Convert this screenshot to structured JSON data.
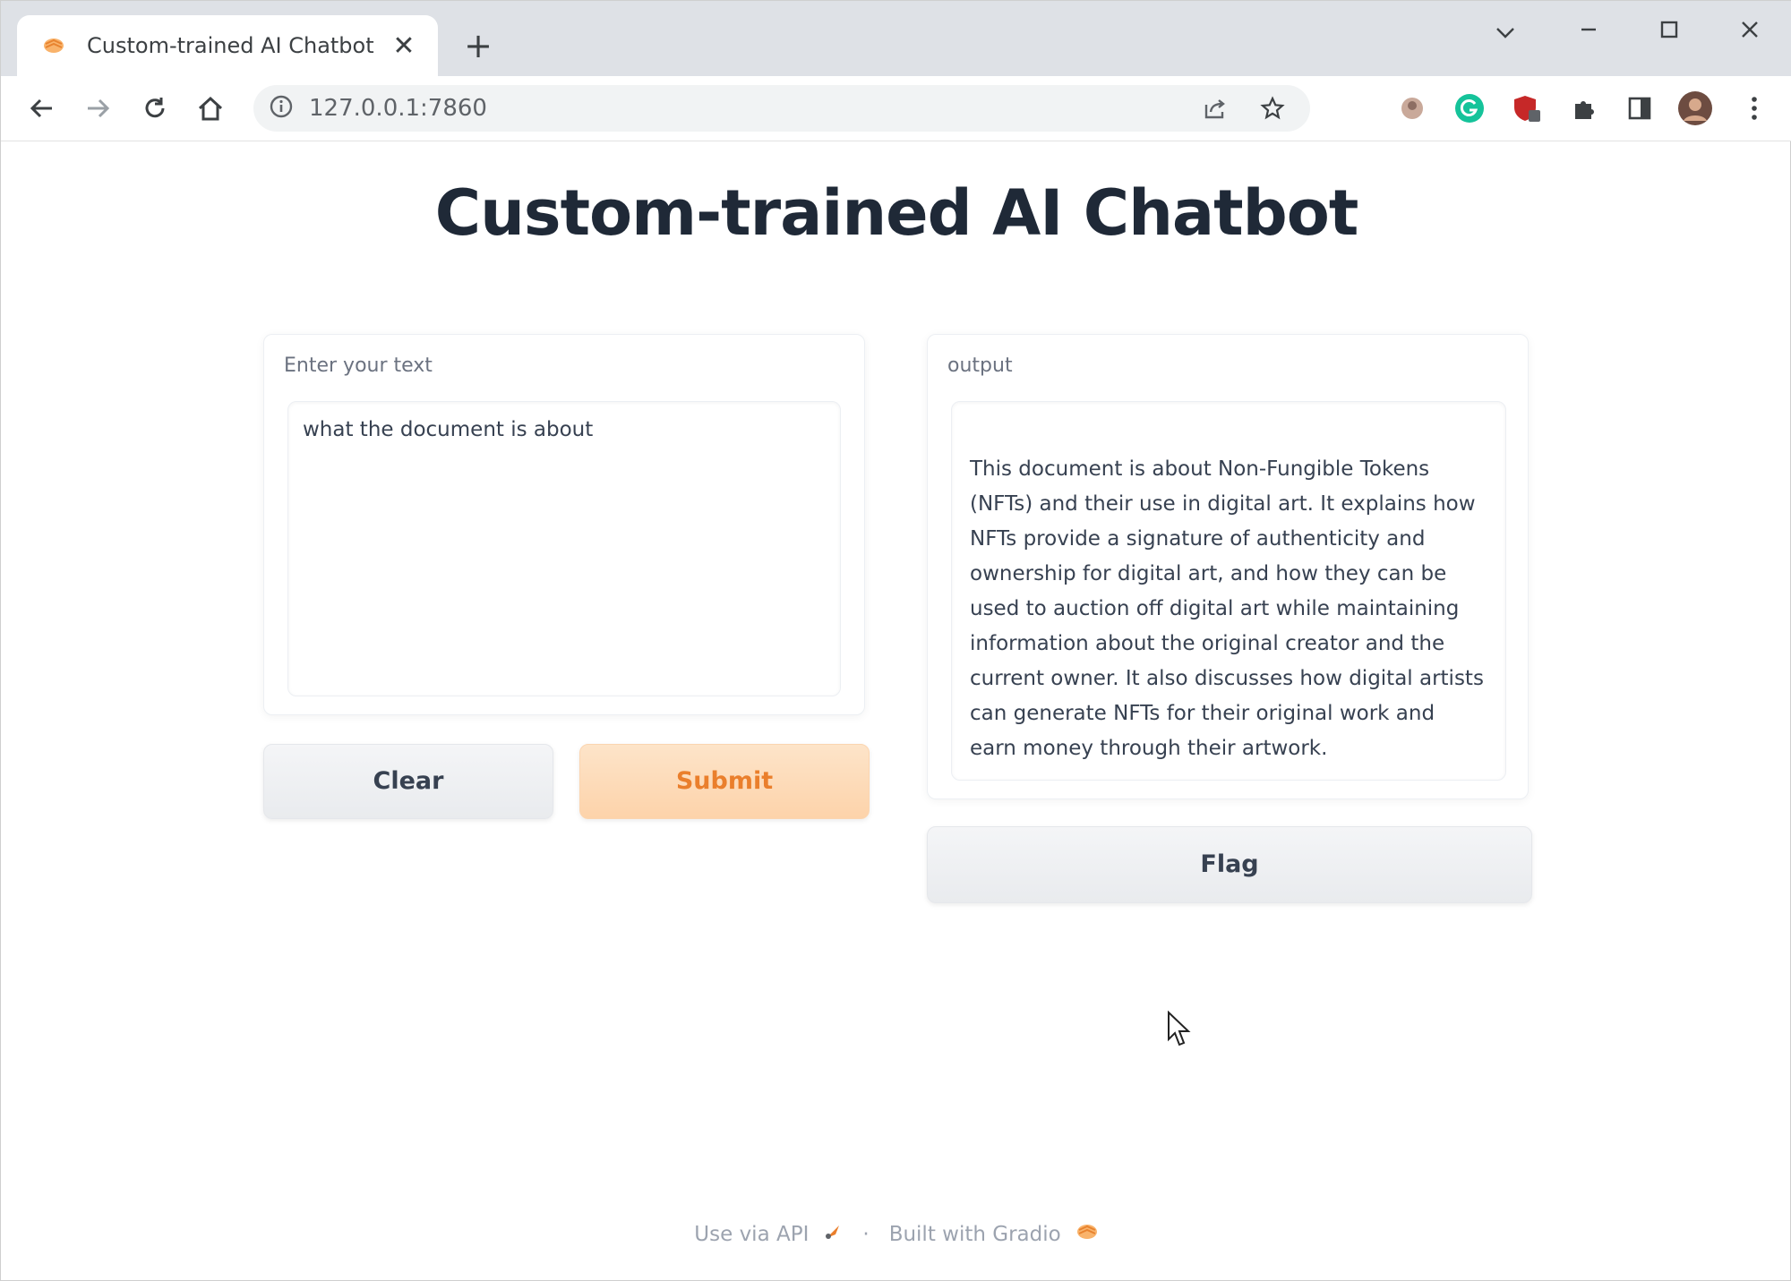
{
  "browser": {
    "tab_title": "Custom-trained AI Chatbot",
    "tab_close": "✕",
    "new_tab": "+",
    "url": "127.0.0.1:7860",
    "window_controls": {
      "dropdown": "⌄",
      "minimize": "–",
      "maximize": "☐",
      "close": "✕"
    }
  },
  "page": {
    "title": "Custom-trained AI Chatbot",
    "input": {
      "label": "Enter your text",
      "value": "what the document is about"
    },
    "output": {
      "label": "output",
      "value": "This document is about Non-Fungible Tokens (NFTs) and their use in digital art. It explains how NFTs provide a signature of authenticity and ownership for digital art, and how they can be used to auction off digital art while maintaining information about the original creator and the current owner. It also discusses how digital artists can generate NFTs for their original work and earn money through their artwork."
    },
    "buttons": {
      "clear": "Clear",
      "submit": "Submit",
      "flag": "Flag"
    },
    "footer": {
      "api_link": "Use via API",
      "separator": "·",
      "built_with": "Built with Gradio"
    }
  },
  "colors": {
    "accent": "#ea7f2c",
    "submit_bg": "#fdd9b5",
    "title": "#1f2937"
  }
}
